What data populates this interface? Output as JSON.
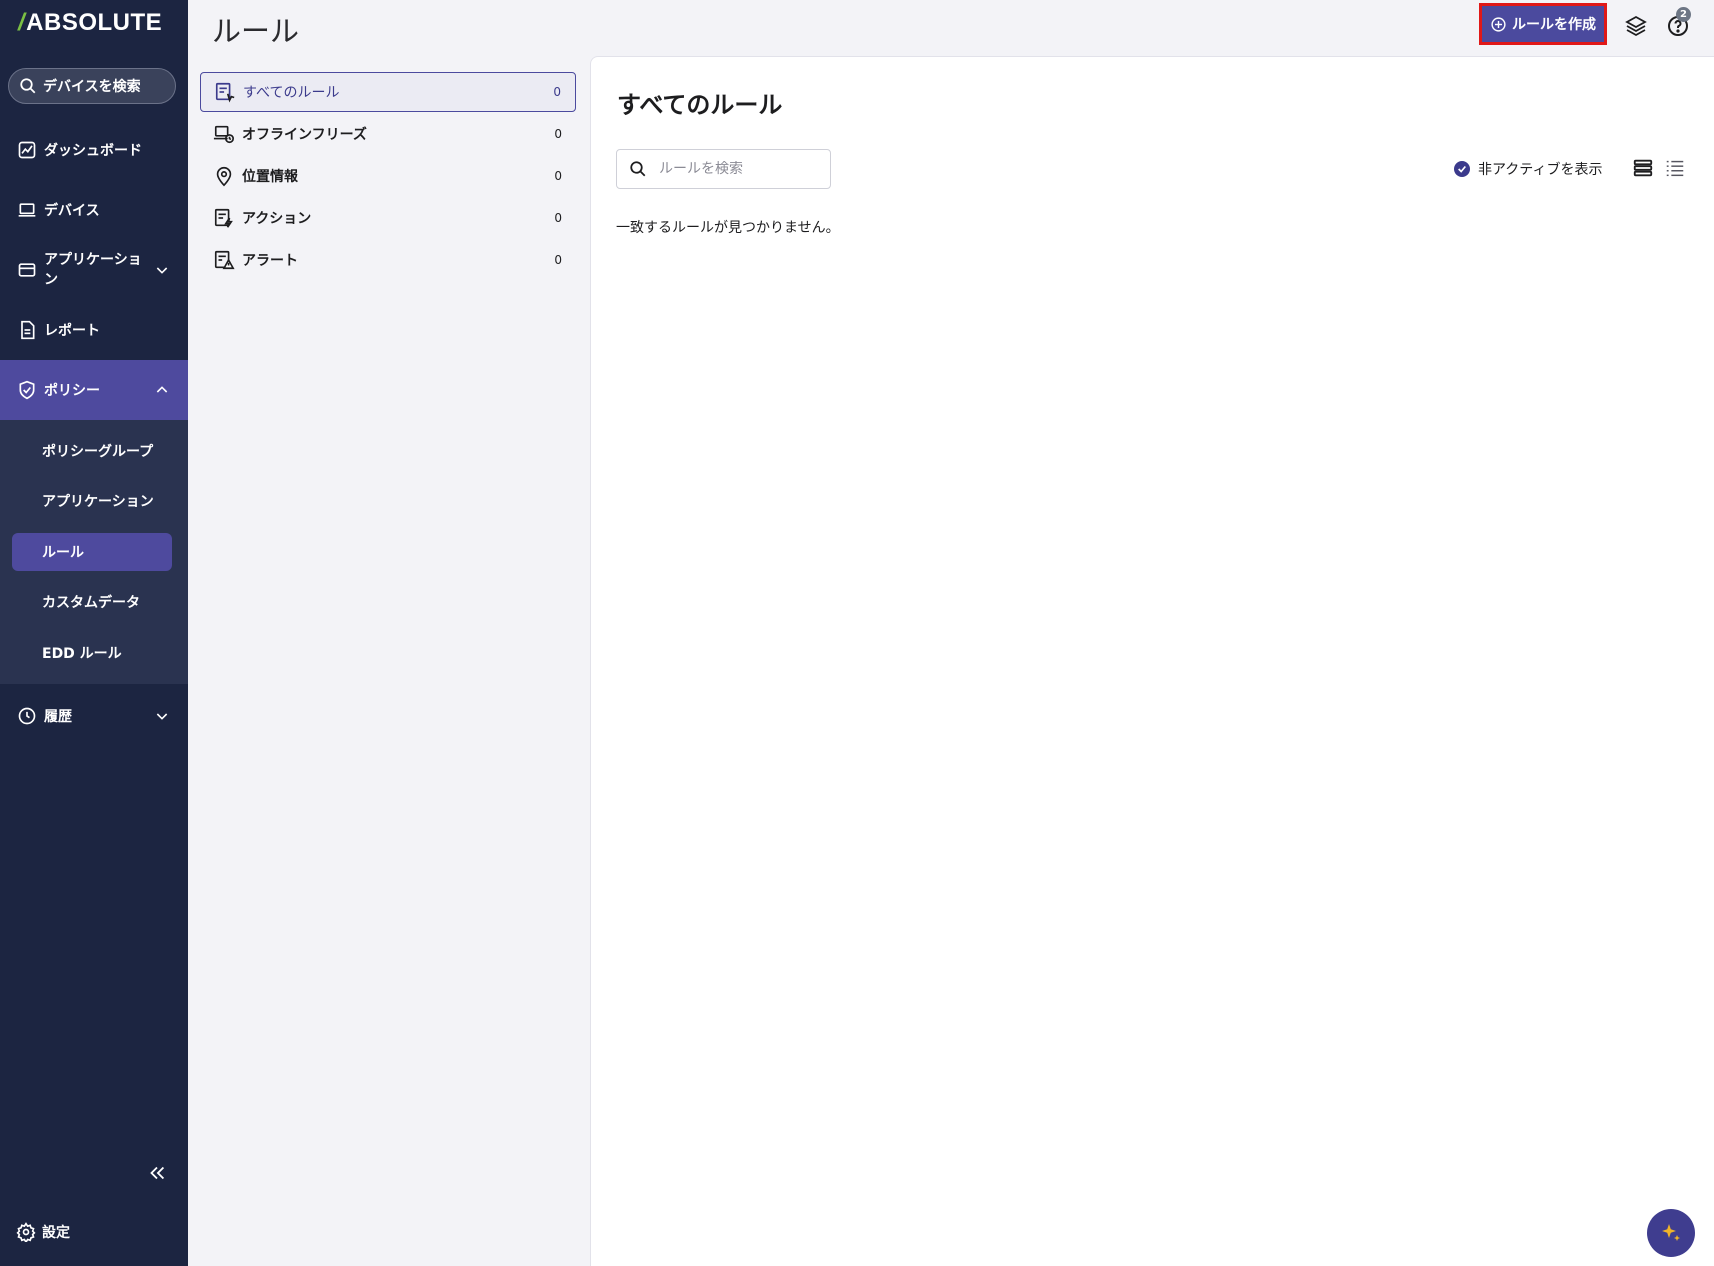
{
  "sidebar": {
    "logo": "ABSOLUTE",
    "search_label": "デバイスを検索",
    "items": [
      {
        "label": "ダッシュボード"
      },
      {
        "label": "デバイス"
      },
      {
        "label": "アプリケーション\nン"
      },
      {
        "label": "レポート"
      },
      {
        "label": "ポリシー"
      },
      {
        "label": "履歴"
      }
    ],
    "app_label_line1": "アプリケーショ",
    "app_label_line2": "ン",
    "policy_sub": [
      {
        "label": "ポリシーグループ"
      },
      {
        "label": "アプリケーション"
      },
      {
        "label": "ルール"
      },
      {
        "label": "カスタムデータ"
      },
      {
        "label": "EDD ルール"
      }
    ],
    "settings_label": "設定"
  },
  "header": {
    "title": "ルール",
    "create_button": "ルールを作成",
    "help_badge": "2"
  },
  "categories": [
    {
      "label": "すべてのルール",
      "count": "0"
    },
    {
      "label": "オフラインフリーズ",
      "count": "0"
    },
    {
      "label": "位置情報",
      "count": "0"
    },
    {
      "label": "アクション",
      "count": "0"
    },
    {
      "label": "アラート",
      "count": "0"
    }
  ],
  "main": {
    "title": "すべてのルール",
    "search_placeholder": "ルールを検索",
    "show_inactive_label": "非アクティブを表示",
    "empty_message": "一致するルールが見つかりません。"
  },
  "colors": {
    "sidebar_bg": "#1c2541",
    "accent": "#4e4a9e",
    "highlight_border": "#e01818",
    "logo_mark": "#7bc043"
  }
}
